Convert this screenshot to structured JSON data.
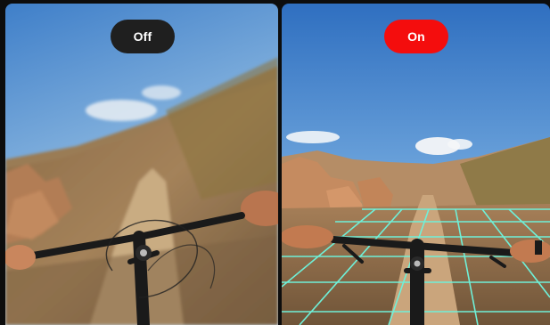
{
  "comparison": {
    "left": {
      "label": "Off",
      "badge_color": "#1f1f1f"
    },
    "right": {
      "label": "On",
      "badge_color": "#f40d0d"
    }
  },
  "grid_color": "#6ff0d8"
}
